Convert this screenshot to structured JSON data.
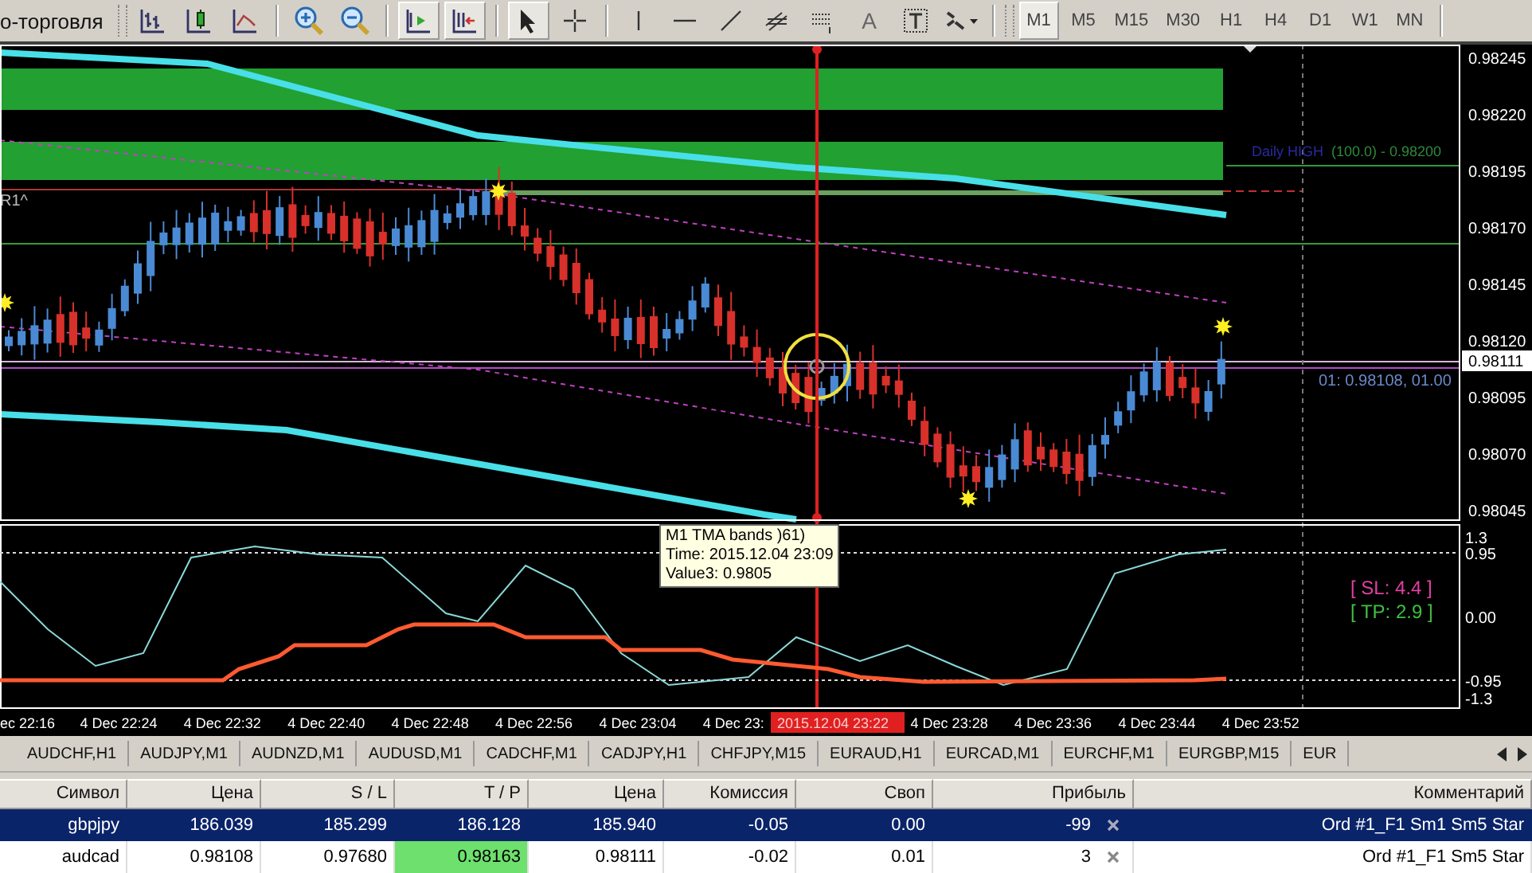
{
  "toolbar": {
    "window_title": "о-торговля",
    "text_tool": "A",
    "timeframes": [
      {
        "label": "M1",
        "selected": true
      },
      {
        "label": "M5",
        "selected": false
      },
      {
        "label": "M15",
        "selected": false
      },
      {
        "label": "M30",
        "selected": false
      },
      {
        "label": "H1",
        "selected": false
      },
      {
        "label": "H4",
        "selected": false
      },
      {
        "label": "D1",
        "selected": false
      },
      {
        "label": "W1",
        "selected": false
      },
      {
        "label": "MN",
        "selected": false
      }
    ]
  },
  "chart": {
    "price_labels": [
      "0.98245",
      "0.98220",
      "0.98195",
      "0.98170",
      "0.98145",
      "0.98120",
      "0.98095",
      "0.98070",
      "0.98045"
    ],
    "current_price": "0.98111",
    "daily_high_label": "Daily HIGH",
    "daily_high_value": "(100.0) -  0.98200",
    "pivot_label": "R1^",
    "order_label": "01: 0.98108,  01.00"
  },
  "indicator": {
    "tooltip": [
      "M1 TMA bands )61)",
      "Time: 2015.12.04 23:09",
      "Value3: 0.9805"
    ],
    "scale_labels": [
      "1.3",
      "0.95",
      "0.00",
      "-0.95",
      "-1.3"
    ],
    "stop_loss": "[ SL: 4.4 ]",
    "take_profit": "[ TP: 2.9 ]"
  },
  "time_axis": {
    "labels": [
      "ec 22:16",
      "4 Dec 22:24",
      "4 Dec 22:32",
      "4 Dec 22:40",
      "4 Dec 22:48",
      "4 Dec 22:56",
      "4 Dec 23:04",
      "4 Dec 23:",
      "4 Dec 23:28",
      "4 Dec 23:36",
      "4 Dec 23:44",
      "4 Dec 23:52"
    ],
    "cursor_time": "2015.12.04 23:22"
  },
  "symbol_tabs": [
    "AUDCHF,H1",
    "AUDJPY,M1",
    "AUDNZD,M1",
    "AUDUSD,M1",
    "CADCHF,M1",
    "CADJPY,H1",
    "CHFJPY,M15",
    "EURAUD,H1",
    "EURCAD,M1",
    "EURCHF,M1",
    "EURGBP,M15",
    "EUR"
  ],
  "table": {
    "columns": [
      "Символ",
      "Цена",
      "S / L",
      "T / P",
      "Цена",
      "Комиссия",
      "Своп",
      "Прибыль",
      "Комментарий"
    ],
    "rows": [
      {
        "cells": [
          "gbpjpy",
          "186.039",
          "185.299",
          "186.128",
          "185.940",
          "-0.05",
          "0.00",
          "-99",
          "Ord #1_F1 Sm1 Sm5 Star"
        ],
        "selected": true,
        "tp_reached": false
      },
      {
        "cells": [
          "audcad",
          "0.98108",
          "0.97680",
          "0.98163",
          "0.98111",
          "-0.02",
          "0.01",
          "3",
          "Ord #1_F1 Sm5 Star"
        ],
        "selected": false,
        "tp_reached": true
      }
    ]
  }
}
